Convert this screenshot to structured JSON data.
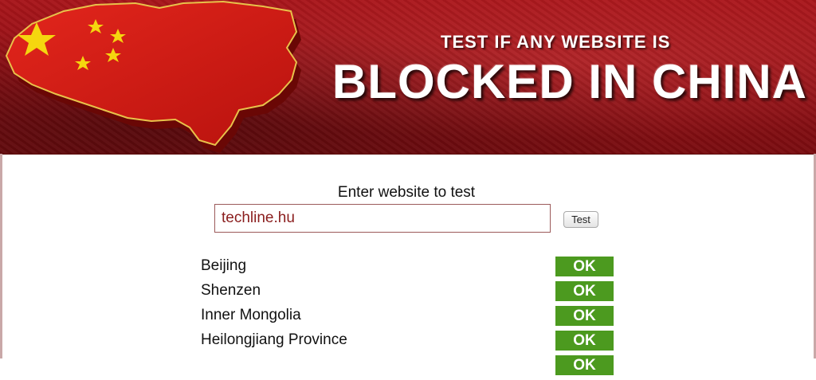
{
  "banner": {
    "headline_small": "TEST IF ANY WEBSITE IS",
    "headline_big": "BLOCKED IN CHINA",
    "map_icon": "china-flag-map-icon"
  },
  "form": {
    "prompt": "Enter website to test",
    "url_value": "techline.hu",
    "test_label": "Test"
  },
  "results": [
    {
      "location": "Beijing",
      "status": "OK"
    },
    {
      "location": "Shenzen",
      "status": "OK"
    },
    {
      "location": "Inner Mongolia",
      "status": "OK"
    },
    {
      "location": "Heilongjiang Province",
      "status": "OK"
    },
    {
      "location": "",
      "status": "OK"
    }
  ],
  "colors": {
    "banner_red": "#9a1217",
    "ok_green": "#4c9a1f",
    "input_text": "#8a1d1d",
    "star_yellow": "#f5d60f"
  }
}
